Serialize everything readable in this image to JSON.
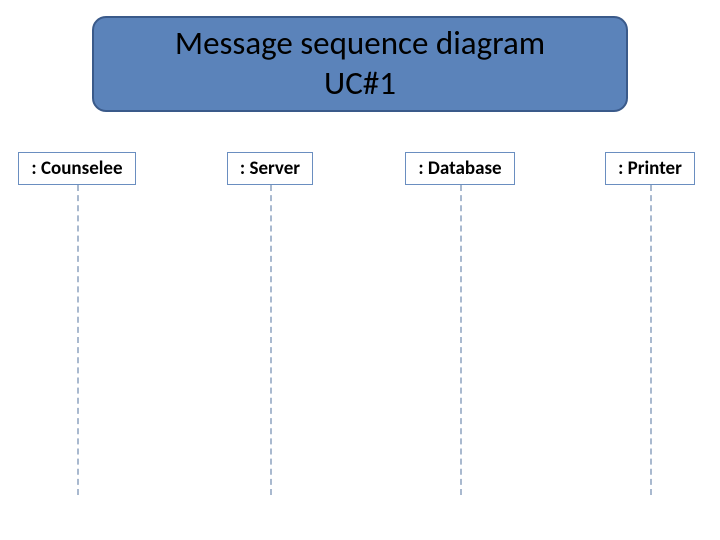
{
  "title": {
    "line1": "Message sequence diagram",
    "line2": "UC#1"
  },
  "participants": [
    {
      "label": ": Counselee"
    },
    {
      "label": ": Server"
    },
    {
      "label": ": Database"
    },
    {
      "label": ": Printer"
    }
  ]
}
